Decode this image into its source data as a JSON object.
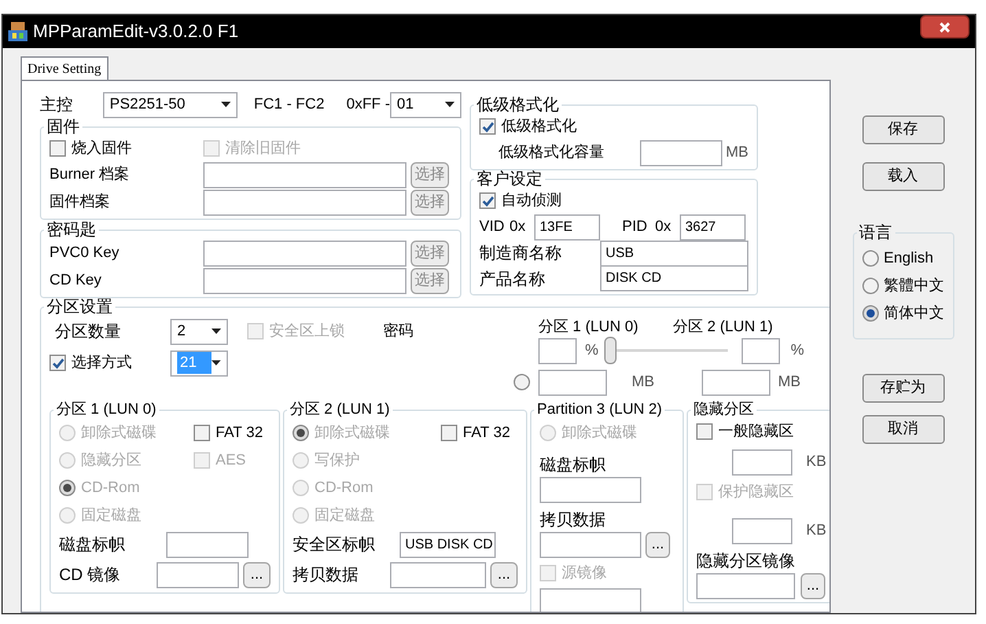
{
  "window": {
    "title": "MPParamEdit-v3.0.2.0 F1"
  },
  "tabs": [
    {
      "label": "Drive Setting",
      "selected": true
    }
  ],
  "controller": {
    "label": "主控",
    "value": "PS2251-50",
    "range": "FC1 - FC2",
    "ff_label": "0xFF -",
    "ff_value": "01"
  },
  "firmware": {
    "title": "固件",
    "burn": {
      "label": "烧入固件",
      "checked": false,
      "disabled": false
    },
    "clear_old": {
      "label": "清除旧固件",
      "checked": false,
      "disabled": true
    },
    "files": [
      {
        "label": "Burner 档案",
        "button": "选择"
      },
      {
        "label": "固件档案",
        "button": "选择"
      }
    ]
  },
  "keys": {
    "title": "密码匙",
    "files": [
      {
        "label": "PVC0 Key",
        "button": "选择"
      },
      {
        "label": "CD Key",
        "button": "选择"
      }
    ]
  },
  "low_format": {
    "title": "低级格式化",
    "enable": {
      "label": "低级格式化",
      "checked": true,
      "disabled": false
    },
    "capacity_label": "低级格式化容量",
    "unit": "MB"
  },
  "customer": {
    "title": "客户设定",
    "auto_detect": {
      "label": "自动侦测",
      "checked": true,
      "disabled": false
    },
    "vid_label": "VID",
    "vid_prefix": "0x",
    "vid": "13FE",
    "pid_label": "PID",
    "pid_prefix": "0x",
    "pid": "3627",
    "vendor_label": "制造商名称",
    "vendor": "USB",
    "product_label": "产品名称",
    "product": "DISK CD"
  },
  "partition_setup": {
    "title": "分区设置",
    "count_label": "分区数量",
    "count": "2",
    "lock": {
      "label": "安全区上锁",
      "checked": false,
      "disabled": true
    },
    "method": {
      "label": "选择方式",
      "checked": true,
      "disabled": false
    },
    "method_value": "21",
    "password_label": "密码",
    "size_columns": [
      {
        "header": "分区 1 (LUN 0)",
        "percent_unit": "%",
        "mb_unit": "MB"
      },
      {
        "header": "分区 2 (LUN 1)",
        "percent_unit": "%",
        "mb_unit": "MB"
      }
    ],
    "split": {
      "level": 0
    },
    "mb_radio": {
      "selected": false
    }
  },
  "partitions": [
    {
      "title": "分区 1 (LUN 0)",
      "modes": [
        {
          "label": "卸除式磁碟",
          "selected": false,
          "disabled": true
        },
        {
          "label": "隐藏分区",
          "selected": false,
          "disabled": true
        },
        {
          "label": "CD-Rom",
          "selected": true,
          "disabled": true
        },
        {
          "label": "固定磁盘",
          "selected": false,
          "disabled": true
        }
      ],
      "options": [
        {
          "label": "FAT 32",
          "checked": false,
          "disabled": false
        },
        {
          "label": "AES",
          "checked": false,
          "disabled": true
        }
      ],
      "fields": [
        {
          "kind": "text",
          "label": "磁盘标帜"
        },
        {
          "kind": "browse",
          "label": "CD 镜像",
          "button": "..."
        }
      ]
    },
    {
      "title": "分区 2 (LUN 1)",
      "modes": [
        {
          "label": "卸除式磁碟",
          "selected": true,
          "disabled": true
        },
        {
          "label": "写保护",
          "selected": false,
          "disabled": true
        },
        {
          "label": "CD-Rom",
          "selected": false,
          "disabled": true
        },
        {
          "label": "固定磁盘",
          "selected": false,
          "disabled": true
        }
      ],
      "options": [
        {
          "label": "FAT 32",
          "checked": false,
          "disabled": false
        }
      ],
      "fields": [
        {
          "kind": "text",
          "label": "安全区标帜",
          "value": "USB DISK CD"
        },
        {
          "kind": "browse",
          "label": "拷贝数据",
          "button": "..."
        }
      ]
    },
    {
      "title": "Partition 3 (LUN 2)",
      "modes": [
        {
          "label": "卸除式磁碟",
          "selected": false,
          "disabled": true
        }
      ],
      "fields": [
        {
          "kind": "stacked",
          "label": "磁盘标帜"
        },
        {
          "kind": "stacked-browse",
          "label": "拷贝数据",
          "button": "..."
        },
        {
          "kind": "check",
          "label": "源镜像",
          "checked": false,
          "disabled": true
        },
        {
          "kind": "input"
        }
      ]
    }
  ],
  "hidden": {
    "title": "隐藏分区",
    "general": {
      "label": "一般隐藏区",
      "checked": false,
      "disabled": false
    },
    "general_unit": "KB",
    "protect": {
      "label": "保护隐藏区",
      "checked": false,
      "disabled": true
    },
    "protect_unit": "KB",
    "image_label": "隐藏分区镜像",
    "button": "..."
  },
  "top_buttons": [
    {
      "label": "保存"
    },
    {
      "label": "载入"
    }
  ],
  "language": {
    "title": "语言",
    "options": [
      {
        "label": "English",
        "selected": false
      },
      {
        "label": "繁體中文",
        "selected": false
      },
      {
        "label": "简体中文",
        "selected": true
      }
    ]
  },
  "bottom_buttons": [
    {
      "label": "存贮为"
    },
    {
      "label": "取消"
    }
  ]
}
